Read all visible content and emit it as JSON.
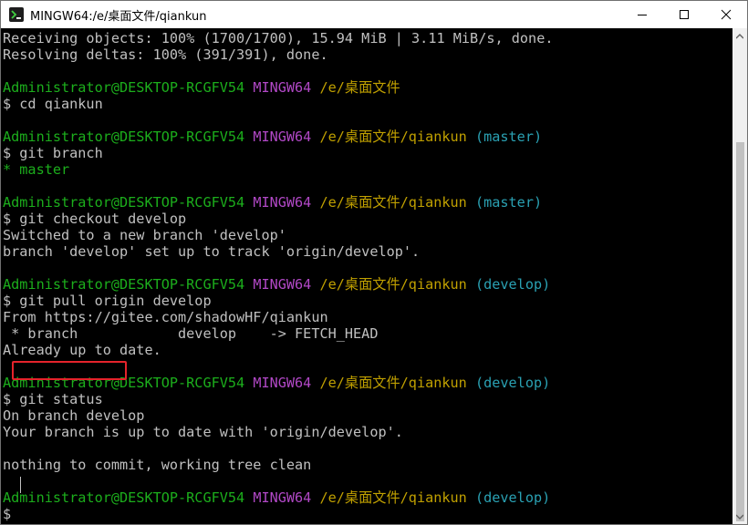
{
  "window": {
    "title": "MINGW64:/e/桌面文件/qiankun",
    "controls": {
      "minimize": "—",
      "maximize": "☐",
      "close": "✕"
    }
  },
  "terminal": {
    "lines": [
      [
        {
          "t": "Receiving objects: 100% (1700/1700), 15.94 MiB | 3.11 MiB/s, done.",
          "c": "w"
        }
      ],
      [
        {
          "t": "Resolving deltas: 100% (391/391), done.",
          "c": "w"
        }
      ],
      [],
      [
        {
          "t": "Administrator@DESKTOP-RCGFV54",
          "c": "g"
        },
        {
          "t": " MINGW64",
          "c": "m"
        },
        {
          "t": " /e/桌面文件",
          "c": "y"
        }
      ],
      [
        {
          "t": "$ cd qiankun",
          "c": "w"
        }
      ],
      [],
      [
        {
          "t": "Administrator@DESKTOP-RCGFV54",
          "c": "g"
        },
        {
          "t": " MINGW64",
          "c": "m"
        },
        {
          "t": " /e/桌面文件/qiankun",
          "c": "y"
        },
        {
          "t": " (master)",
          "c": "c"
        }
      ],
      [
        {
          "t": "$ git branch",
          "c": "w"
        }
      ],
      [
        {
          "t": "* master",
          "c": "g"
        }
      ],
      [],
      [
        {
          "t": "Administrator@DESKTOP-RCGFV54",
          "c": "g"
        },
        {
          "t": " MINGW64",
          "c": "m"
        },
        {
          "t": " /e/桌面文件/qiankun",
          "c": "y"
        },
        {
          "t": " (master)",
          "c": "c"
        }
      ],
      [
        {
          "t": "$ git checkout develop",
          "c": "w"
        }
      ],
      [
        {
          "t": "Switched to a new branch 'develop'",
          "c": "w"
        }
      ],
      [
        {
          "t": "branch 'develop' set up to track 'origin/develop'.",
          "c": "w"
        }
      ],
      [],
      [
        {
          "t": "Administrator@DESKTOP-RCGFV54",
          "c": "g"
        },
        {
          "t": " MINGW64",
          "c": "m"
        },
        {
          "t": " /e/桌面文件/qiankun",
          "c": "y"
        },
        {
          "t": " (develop)",
          "c": "c"
        }
      ],
      [
        {
          "t": "$ git pull origin develop",
          "c": "w"
        }
      ],
      [
        {
          "t": "From https://gitee.com/shadowHF/qiankun",
          "c": "w"
        }
      ],
      [
        {
          "t": " * branch            develop    -> FETCH_HEAD",
          "c": "w"
        }
      ],
      [
        {
          "t": "Already up to date.",
          "c": "w"
        }
      ],
      [],
      [
        {
          "t": "Administrator@DESKTOP-RCGFV54",
          "c": "g"
        },
        {
          "t": " MINGW64",
          "c": "m"
        },
        {
          "t": " /e/桌面文件/qiankun",
          "c": "y"
        },
        {
          "t": " (develop)",
          "c": "c"
        }
      ],
      [
        {
          "t": "$ git status",
          "c": "w"
        }
      ],
      [
        {
          "t": "On branch develop",
          "c": "w"
        }
      ],
      [
        {
          "t": "Your branch is up to date with 'origin/develop'.",
          "c": "w"
        }
      ],
      [],
      [
        {
          "t": "nothing to commit, working tree clean",
          "c": "w"
        }
      ],
      [],
      [
        {
          "t": "Administrator@DESKTOP-RCGFV54",
          "c": "g"
        },
        {
          "t": " MINGW64",
          "c": "m"
        },
        {
          "t": " /e/桌面文件/qiankun",
          "c": "y"
        },
        {
          "t": " (develop)",
          "c": "c"
        }
      ],
      [
        {
          "t": "$ ",
          "c": "w"
        }
      ]
    ]
  },
  "colors": {
    "user_host": "#1cae1c",
    "shell": "#b148c6",
    "path": "#c0a000",
    "branch": "#2aa1b3",
    "text": "#c0c0c0",
    "highlight_box": "#e5232b"
  },
  "icons": {
    "app": "mingw-icon",
    "scroll_up": "scroll-up-arrow-icon",
    "scroll_down": "scroll-down-arrow-icon"
  }
}
